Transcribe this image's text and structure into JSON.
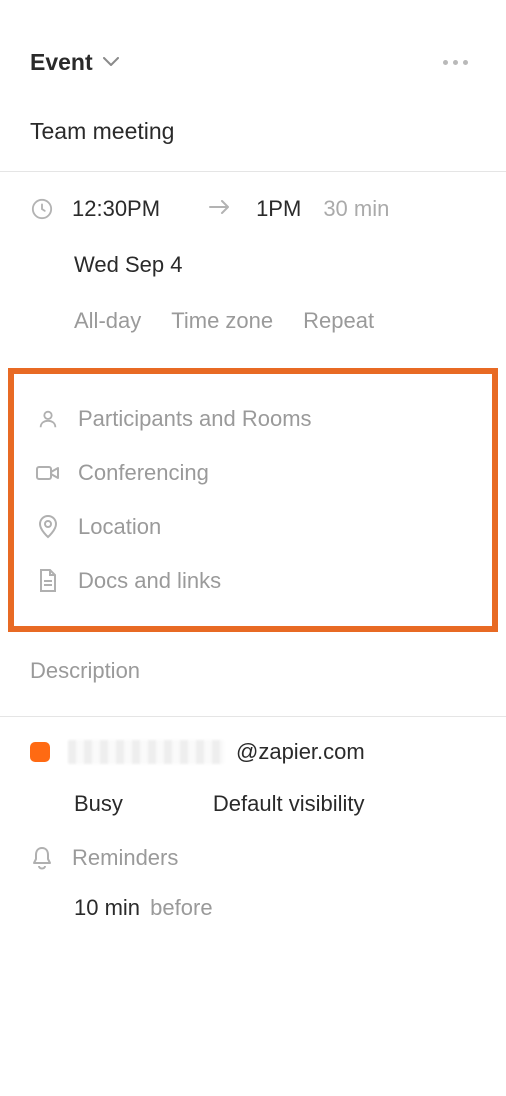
{
  "header": {
    "type_label": "Event"
  },
  "title": "Team meeting",
  "time": {
    "start": "12:30PM",
    "end": "1PM",
    "duration": "30 min",
    "date": "Wed Sep 4",
    "all_day_label": "All-day",
    "timezone_label": "Time zone",
    "repeat_label": "Repeat"
  },
  "fields": {
    "participants": "Participants and Rooms",
    "conferencing": "Conferencing",
    "location": "Location",
    "docs": "Docs and links"
  },
  "description_label": "Description",
  "owner": {
    "email_suffix": "@zapier.com",
    "busy_label": "Busy",
    "visibility_label": "Default visibility"
  },
  "reminders": {
    "label": "Reminders",
    "value": "10 min",
    "before": "before"
  }
}
